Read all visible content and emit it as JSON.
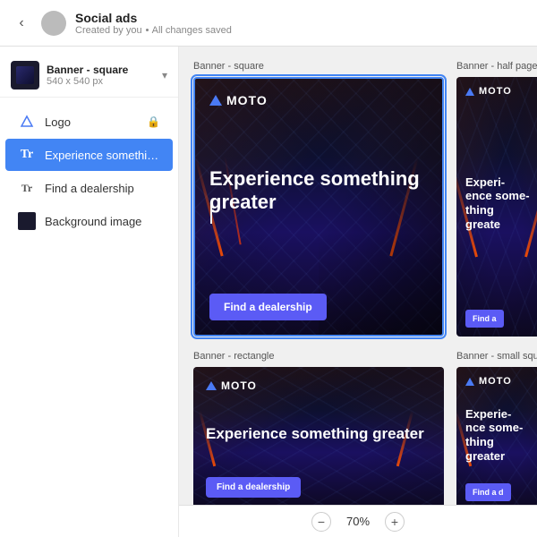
{
  "topbar": {
    "back_icon": "‹",
    "title": "Social ads",
    "subtitle_created": "Created by you",
    "subtitle_separator": "•",
    "subtitle_status": "All changes saved"
  },
  "sidebar": {
    "banner_selector": {
      "name": "Banner - square",
      "size": "540 x 540 px"
    },
    "items": [
      {
        "id": "logo",
        "label": "Logo",
        "icon": "logo",
        "locked": true,
        "active": false
      },
      {
        "id": "experience",
        "label": "Experience something...",
        "icon": "text",
        "locked": false,
        "active": true
      },
      {
        "id": "dealership",
        "label": "Find a dealership",
        "icon": "text",
        "locked": false,
        "active": false
      },
      {
        "id": "background",
        "label": "Background image",
        "icon": "image",
        "locked": false,
        "active": false
      }
    ]
  },
  "canvas": {
    "zoom_value": "70%",
    "zoom_minus": "−",
    "zoom_plus": "+",
    "banners": [
      {
        "id": "square",
        "label": "Banner - square",
        "logo": "MOTO",
        "headline": "Experience something greater",
        "cta": "Find a dealership",
        "selected": true
      },
      {
        "id": "half-page",
        "label": "Banner - half page",
        "logo": "MOTO",
        "headline": "Experience something greater",
        "cta": "Find a",
        "selected": false
      },
      {
        "id": "rectangle",
        "label": "Banner - rectangle",
        "logo": "MOTO",
        "headline": "Experience something greater",
        "cta": "Find a dealership",
        "selected": false
      },
      {
        "id": "small-square",
        "label": "Banner - small square",
        "logo": "MOTO",
        "headline": "Experience something greater",
        "cta": "Find a d",
        "selected": false
      }
    ]
  }
}
